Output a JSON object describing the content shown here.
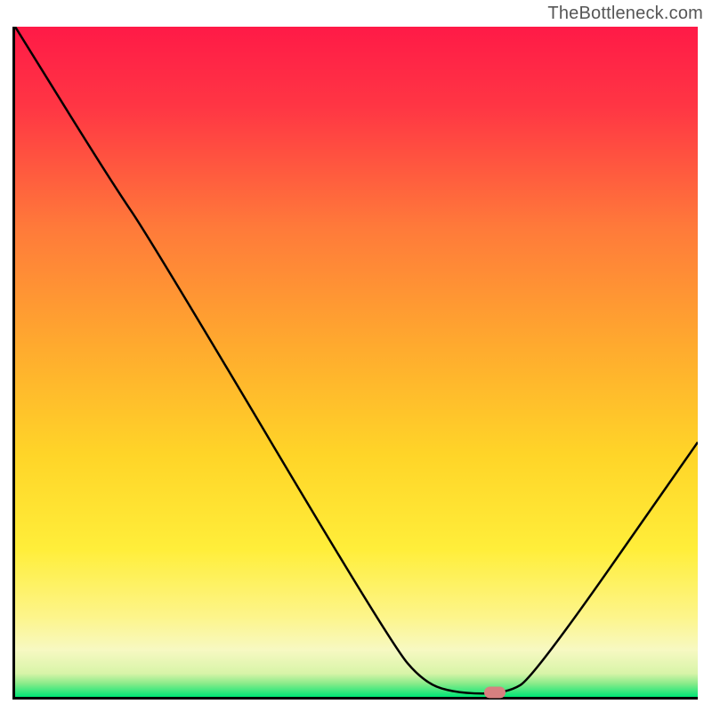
{
  "watermark": "TheBottleneck.com",
  "chart_data": {
    "type": "line",
    "title": "",
    "xlabel": "",
    "ylabel": "",
    "xlim": [
      0,
      100
    ],
    "ylim": [
      0,
      100
    ],
    "gradient_colors": {
      "top": "#ff1744",
      "upper_mid": "#ff7043",
      "mid": "#ffca28",
      "lower_mid": "#ffee58",
      "pale": "#fff59d",
      "green": "#00e676"
    },
    "curve": [
      {
        "x": 0,
        "y": 100
      },
      {
        "x": 14,
        "y": 77
      },
      {
        "x": 20,
        "y": 68
      },
      {
        "x": 55,
        "y": 8
      },
      {
        "x": 60,
        "y": 2
      },
      {
        "x": 65,
        "y": 0.5
      },
      {
        "x": 72,
        "y": 0.5
      },
      {
        "x": 76,
        "y": 3
      },
      {
        "x": 100,
        "y": 38
      }
    ],
    "marker": {
      "x": 70,
      "y": 0.7
    }
  }
}
